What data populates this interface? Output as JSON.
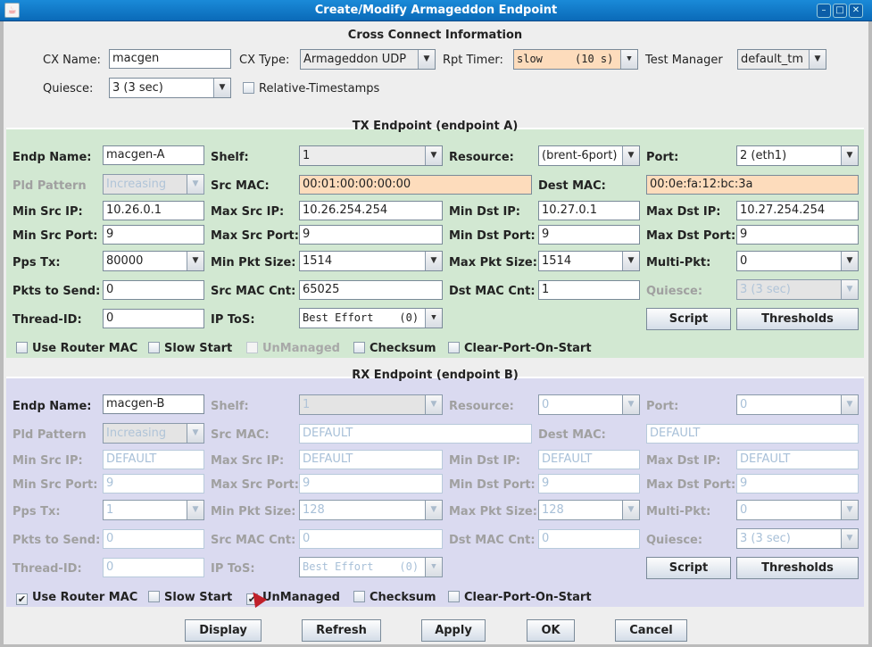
{
  "window": {
    "title": "Create/Modify Armageddon Endpoint",
    "icon": "java-cup-icon",
    "controls": [
      "minimize",
      "maximize",
      "close"
    ]
  },
  "cx": {
    "legend": "Cross Connect Information",
    "name_label": "CX Name:",
    "name_value": "macgen",
    "type_label": "CX Type:",
    "type_value": "Armageddon UDP",
    "rpt_label": "Rpt Timer:",
    "rpt_value": "slow     (10 s)",
    "tm_label": "Test Manager",
    "tm_value": "default_tm",
    "quiesce_label": "Quiesce:",
    "quiesce_value": "3 (3 sec)",
    "reltime_label": "Relative-Timestamps",
    "reltime_checked": false
  },
  "labels": {
    "endp_name": "Endp Name:",
    "shelf": "Shelf:",
    "resource": "Resource:",
    "port": "Port:",
    "pld_pattern": "Pld Pattern",
    "src_mac": "Src MAC:",
    "dest_mac": "Dest MAC:",
    "min_src_ip": "Min Src IP:",
    "max_src_ip": "Max Src IP:",
    "min_dst_ip": "Min Dst IP:",
    "max_dst_ip": "Max Dst IP:",
    "min_src_port": "Min Src Port:",
    "max_src_port": "Max Src Port:",
    "min_dst_port": "Min Dst Port:",
    "max_dst_port": "Max Dst Port:",
    "pps_tx": "Pps Tx:",
    "min_pkt": "Min Pkt Size:",
    "max_pkt": "Max Pkt Size:",
    "multi_pkt": "Multi-Pkt:",
    "pkts_send": "Pkts to Send:",
    "src_mac_cnt": "Src MAC Cnt:",
    "dst_mac_cnt": "Dst MAC Cnt:",
    "quiesce": "Quiesce:",
    "thread_id": "Thread-ID:",
    "ip_tos": "IP ToS:",
    "script": "Script",
    "thresholds": "Thresholds",
    "use_router_mac": "Use Router MAC",
    "slow_start": "Slow Start",
    "unmanaged": "UnManaged",
    "checksum": "Checksum",
    "clear_port": "Clear-Port-On-Start"
  },
  "tx": {
    "legend": "TX Endpoint (endpoint A)",
    "endp_name": "macgen-A",
    "shelf": "1",
    "resource": "(brent-6port)",
    "port": "2 (eth1)",
    "pld_pattern": "Increasing",
    "src_mac": "00:01:00:00:00:00",
    "dest_mac": "00:0e:fa:12:bc:3a",
    "min_src_ip": "10.26.0.1",
    "max_src_ip": "10.26.254.254",
    "min_dst_ip": "10.27.0.1",
    "max_dst_ip": "10.27.254.254",
    "min_src_port": "9",
    "max_src_port": "9",
    "min_dst_port": "9",
    "max_dst_port": "9",
    "pps_tx": "80000",
    "min_pkt": "1514",
    "max_pkt": "1514",
    "multi_pkt": "0",
    "pkts_send": "0",
    "src_mac_cnt": "65025",
    "dst_mac_cnt": "1",
    "quiesce": "3 (3 sec)",
    "thread_id": "0",
    "ip_tos": "Best Effort    (0)",
    "use_router_mac": false,
    "slow_start": false,
    "unmanaged": false,
    "checksum": false,
    "clear_port": false
  },
  "rx": {
    "legend": "RX Endpoint (endpoint B)",
    "endp_name": "macgen-B",
    "shelf": "1",
    "resource": "0",
    "port": "0",
    "pld_pattern": "Increasing",
    "src_mac": "DEFAULT",
    "dest_mac": "DEFAULT",
    "min_src_ip": "DEFAULT",
    "max_src_ip": "DEFAULT",
    "min_dst_ip": "DEFAULT",
    "max_dst_ip": "DEFAULT",
    "min_src_port": "9",
    "max_src_port": "9",
    "min_dst_port": "9",
    "max_dst_port": "9",
    "pps_tx": "1",
    "min_pkt": "128",
    "max_pkt": "128",
    "multi_pkt": "0",
    "pkts_send": "0",
    "src_mac_cnt": "0",
    "dst_mac_cnt": "0",
    "quiesce": "3 (3 sec)",
    "thread_id": "0",
    "ip_tos": "Best Effort    (0)",
    "use_router_mac": true,
    "slow_start": false,
    "unmanaged": true,
    "checksum": false,
    "clear_port": false
  },
  "buttons": {
    "display": "Display",
    "refresh": "Refresh",
    "apply": "Apply",
    "ok": "OK",
    "cancel": "Cancel"
  },
  "colors": {
    "tx_bg": "#d2e8d2",
    "rx_bg": "#dadaf0",
    "highlight": "#fddcbc",
    "titlebar": "#0a6ab8"
  }
}
